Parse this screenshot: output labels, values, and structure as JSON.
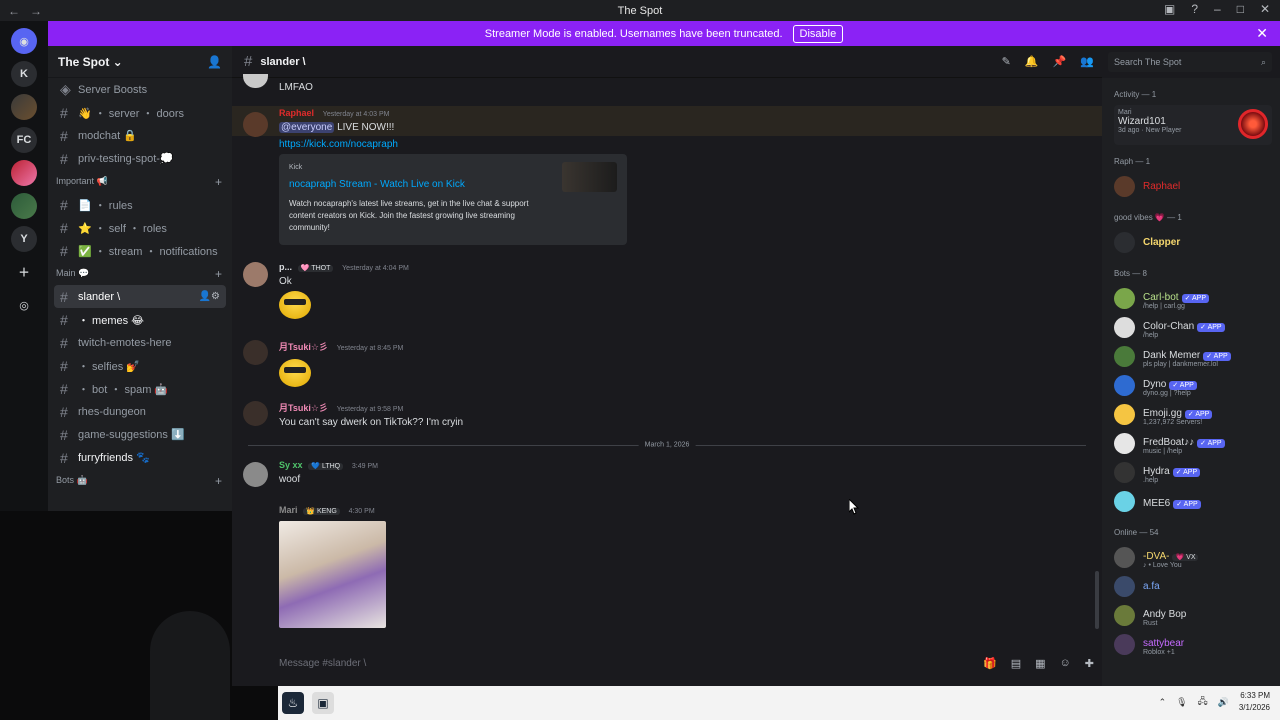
{
  "window": {
    "title": "The Spot",
    "nav_back": "←",
    "nav_forward": "→"
  },
  "banner": {
    "text": "Streamer Mode is enabled. Usernames have been truncated.",
    "action": "Disable"
  },
  "server_rail": [
    "K",
    "FC",
    "Y"
  ],
  "server": {
    "name": "The Spot"
  },
  "channels": [
    {
      "type": "channel",
      "label": "Server Boosts",
      "icon": "boost-icon"
    },
    {
      "type": "channel",
      "label": "👋 ・ server ・ doors"
    },
    {
      "type": "channel",
      "label": "modchat 🔒"
    },
    {
      "type": "channel",
      "label": "priv-testing-spot-💭"
    },
    {
      "type": "category",
      "label": "Important 📢"
    },
    {
      "type": "channel",
      "label": "📄 ・ rules"
    },
    {
      "type": "channel",
      "label": "⭐ ・ self ・ roles"
    },
    {
      "type": "channel",
      "label": "✅ ・ stream ・ notifications"
    },
    {
      "type": "category",
      "label": "Main 💬"
    },
    {
      "type": "channel",
      "label": "slander \\",
      "active": true
    },
    {
      "type": "channel",
      "label": "・ memes 😂",
      "bold": true
    },
    {
      "type": "channel",
      "label": "twitch-emotes-here"
    },
    {
      "type": "channel",
      "label": "・ selfies 💅"
    },
    {
      "type": "channel",
      "label": "・ bot ・ spam 🤖"
    },
    {
      "type": "channel",
      "label": "rhes-dungeon"
    },
    {
      "type": "channel",
      "label": "game-suggestions ⬇️"
    },
    {
      "type": "channel",
      "label": "furryfriends 🐾",
      "bold": true
    },
    {
      "type": "category",
      "label": "Bots 🤖"
    }
  ],
  "header": {
    "channel": "slander \\"
  },
  "messages": [
    {
      "text": "LMFAO"
    },
    {
      "author": "Raphael",
      "time": "Yesterday at 4:03 PM",
      "mention": "@everyone",
      "text": "LIVE NOW!!!",
      "link": "https://kick.com/nocapraph"
    },
    {
      "author": "p...",
      "badge": "🩷 THOT",
      "time": "Yesterday at 4:04 PM",
      "text": "Ok"
    },
    {
      "author": "月Tsuki☆彡",
      "time": "Yesterday at 8:45 PM"
    },
    {
      "author": "月Tsuki☆彡",
      "time": "Yesterday at 9:58 PM",
      "text": "You can't say dwerk on TikTok?? I'm cryin"
    },
    {
      "author": "Sy xx",
      "badge": "💙 LTHQ",
      "time": "3:49 PM",
      "text": "woof"
    },
    {
      "author": "Mari",
      "badge": "👑 KENG",
      "time": "4:30 PM"
    }
  ],
  "embed": {
    "provider": "Kick",
    "title": "nocapraph Stream - Watch Live on Kick",
    "description": "Watch nocapraph's latest live streams, get in the live chat & support content creators on Kick. Join the fastest growing live streaming community!"
  },
  "date_divider": "March 1, 2026",
  "composer": {
    "placeholder": "Message #slander \\"
  },
  "search": {
    "placeholder": "Search The Spot"
  },
  "members": {
    "activity_header": "Activity — 1",
    "activity": {
      "user": "Mari",
      "game": "Wizard101",
      "detail": "3d ago",
      "tag": "New Player"
    },
    "groups": [
      {
        "header": "Raph — 1",
        "items": [
          {
            "name": "Raphael",
            "color": "#e02b2b"
          }
        ]
      },
      {
        "header": "good vibes 💗 — 1",
        "items": [
          {
            "name": "Clapper",
            "color": "#f5d76e"
          }
        ]
      },
      {
        "header": "Bots — 8",
        "items": [
          {
            "name": "Carl-bot",
            "sub": "/help | carl.gg",
            "app": "✓ APP",
            "color": "#b8e08a"
          },
          {
            "name": "Color-Chan",
            "sub": "/help",
            "app": "✓ APP",
            "color": "#dbdee1"
          },
          {
            "name": "Dank Memer",
            "sub": "pls play | dankmemer.lol",
            "app": "✓ APP",
            "color": "#dbdee1"
          },
          {
            "name": "Dyno",
            "sub": "dyno.gg | ?help",
            "app": "✓ APP",
            "color": "#dbdee1"
          },
          {
            "name": "Emoji.gg",
            "sub": "1,237,972 Servers!",
            "app": "✓ APP",
            "color": "#dbdee1"
          },
          {
            "name": "FredBoat♪♪",
            "sub": "music | /help",
            "app": "✓ APP",
            "color": "#dbdee1"
          },
          {
            "name": "Hydra",
            "sub": ".help",
            "app": "✓ APP",
            "color": "#dbdee1"
          },
          {
            "name": "MEE6",
            "sub": "",
            "app": "✓ APP",
            "color": "#dbdee1"
          }
        ]
      },
      {
        "header": "Online — 54",
        "items": [
          {
            "name": "-DVA-",
            "badge": "💗 VX",
            "sub": "♪ • Love You",
            "color": "#f5d76e"
          },
          {
            "name": "a.fa",
            "color": "#7aa6f5"
          },
          {
            "name": "Andy Bop",
            "sub": "Rust",
            "color": "#dbdee1"
          },
          {
            "name": "sattybear",
            "sub": "Roblox +1",
            "color": "#c56bff"
          }
        ]
      }
    ]
  },
  "taskbar": {
    "time": "6:33 PM",
    "date": "3/1/2026"
  }
}
